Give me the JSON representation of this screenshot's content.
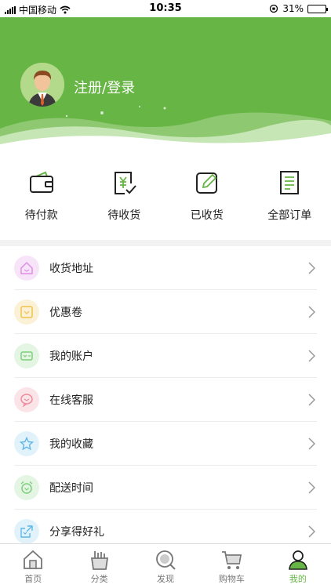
{
  "status_bar": {
    "carrier": "中国移动",
    "time": "10:35",
    "battery": "31%",
    "battery_level": 0.31
  },
  "header": {
    "login_text": "注册/登录",
    "bg_color": "#67b545"
  },
  "orders": [
    {
      "label": "待付款",
      "icon": "wallet-icon"
    },
    {
      "label": "待收货",
      "icon": "receipt-icon"
    },
    {
      "label": "已收货",
      "icon": "edit-box-icon"
    },
    {
      "label": "全部订单",
      "icon": "document-icon"
    }
  ],
  "menu": [
    {
      "label": "收货地址",
      "icon": "home-icon",
      "color": "#e08de8"
    },
    {
      "label": "优惠卷",
      "icon": "coupon-icon",
      "color": "#f0c24b"
    },
    {
      "label": "我的账户",
      "icon": "wallet-icon",
      "color": "#7ccf7a"
    },
    {
      "label": "在线客服",
      "icon": "chat-icon",
      "color": "#f08a9a"
    },
    {
      "label": "我的收藏",
      "icon": "star-icon",
      "color": "#5fb6e8"
    },
    {
      "label": "配送时间",
      "icon": "alarm-clock-icon",
      "color": "#7ccf7a"
    },
    {
      "label": "分享得好礼",
      "icon": "share-icon",
      "color": "#5fb6e8"
    }
  ],
  "tabbar": [
    {
      "label": "首页",
      "icon": "home-icon"
    },
    {
      "label": "分类",
      "icon": "category-icon"
    },
    {
      "label": "发现",
      "icon": "discover-icon"
    },
    {
      "label": "购物车",
      "icon": "cart-icon"
    },
    {
      "label": "我的",
      "icon": "user-icon",
      "active": true
    }
  ]
}
